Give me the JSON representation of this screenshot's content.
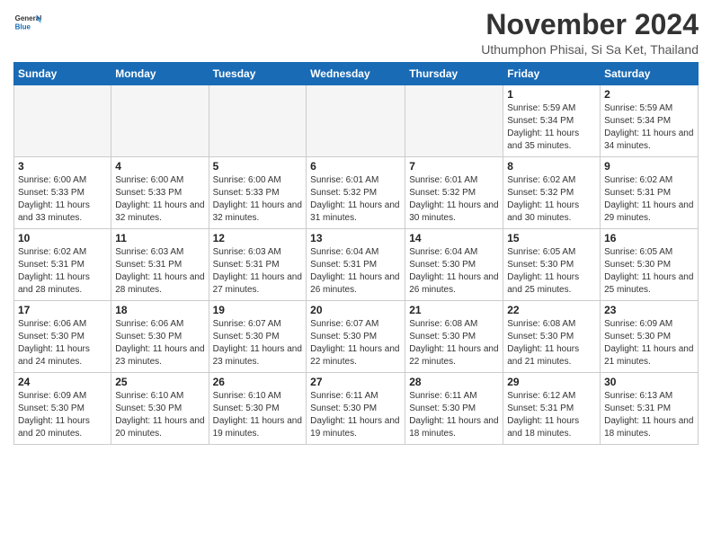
{
  "header": {
    "logo_line1": "General",
    "logo_line2": "Blue",
    "month": "November 2024",
    "location": "Uthumphon Phisai, Si Sa Ket, Thailand"
  },
  "days_of_week": [
    "Sunday",
    "Monday",
    "Tuesday",
    "Wednesday",
    "Thursday",
    "Friday",
    "Saturday"
  ],
  "weeks": [
    [
      {
        "day": "",
        "info": ""
      },
      {
        "day": "",
        "info": ""
      },
      {
        "day": "",
        "info": ""
      },
      {
        "day": "",
        "info": ""
      },
      {
        "day": "",
        "info": ""
      },
      {
        "day": "1",
        "info": "Sunrise: 5:59 AM\nSunset: 5:34 PM\nDaylight: 11 hours and 35 minutes."
      },
      {
        "day": "2",
        "info": "Sunrise: 5:59 AM\nSunset: 5:34 PM\nDaylight: 11 hours and 34 minutes."
      }
    ],
    [
      {
        "day": "3",
        "info": "Sunrise: 6:00 AM\nSunset: 5:33 PM\nDaylight: 11 hours and 33 minutes."
      },
      {
        "day": "4",
        "info": "Sunrise: 6:00 AM\nSunset: 5:33 PM\nDaylight: 11 hours and 32 minutes."
      },
      {
        "day": "5",
        "info": "Sunrise: 6:00 AM\nSunset: 5:33 PM\nDaylight: 11 hours and 32 minutes."
      },
      {
        "day": "6",
        "info": "Sunrise: 6:01 AM\nSunset: 5:32 PM\nDaylight: 11 hours and 31 minutes."
      },
      {
        "day": "7",
        "info": "Sunrise: 6:01 AM\nSunset: 5:32 PM\nDaylight: 11 hours and 30 minutes."
      },
      {
        "day": "8",
        "info": "Sunrise: 6:02 AM\nSunset: 5:32 PM\nDaylight: 11 hours and 30 minutes."
      },
      {
        "day": "9",
        "info": "Sunrise: 6:02 AM\nSunset: 5:31 PM\nDaylight: 11 hours and 29 minutes."
      }
    ],
    [
      {
        "day": "10",
        "info": "Sunrise: 6:02 AM\nSunset: 5:31 PM\nDaylight: 11 hours and 28 minutes."
      },
      {
        "day": "11",
        "info": "Sunrise: 6:03 AM\nSunset: 5:31 PM\nDaylight: 11 hours and 28 minutes."
      },
      {
        "day": "12",
        "info": "Sunrise: 6:03 AM\nSunset: 5:31 PM\nDaylight: 11 hours and 27 minutes."
      },
      {
        "day": "13",
        "info": "Sunrise: 6:04 AM\nSunset: 5:31 PM\nDaylight: 11 hours and 26 minutes."
      },
      {
        "day": "14",
        "info": "Sunrise: 6:04 AM\nSunset: 5:30 PM\nDaylight: 11 hours and 26 minutes."
      },
      {
        "day": "15",
        "info": "Sunrise: 6:05 AM\nSunset: 5:30 PM\nDaylight: 11 hours and 25 minutes."
      },
      {
        "day": "16",
        "info": "Sunrise: 6:05 AM\nSunset: 5:30 PM\nDaylight: 11 hours and 25 minutes."
      }
    ],
    [
      {
        "day": "17",
        "info": "Sunrise: 6:06 AM\nSunset: 5:30 PM\nDaylight: 11 hours and 24 minutes."
      },
      {
        "day": "18",
        "info": "Sunrise: 6:06 AM\nSunset: 5:30 PM\nDaylight: 11 hours and 23 minutes."
      },
      {
        "day": "19",
        "info": "Sunrise: 6:07 AM\nSunset: 5:30 PM\nDaylight: 11 hours and 23 minutes."
      },
      {
        "day": "20",
        "info": "Sunrise: 6:07 AM\nSunset: 5:30 PM\nDaylight: 11 hours and 22 minutes."
      },
      {
        "day": "21",
        "info": "Sunrise: 6:08 AM\nSunset: 5:30 PM\nDaylight: 11 hours and 22 minutes."
      },
      {
        "day": "22",
        "info": "Sunrise: 6:08 AM\nSunset: 5:30 PM\nDaylight: 11 hours and 21 minutes."
      },
      {
        "day": "23",
        "info": "Sunrise: 6:09 AM\nSunset: 5:30 PM\nDaylight: 11 hours and 21 minutes."
      }
    ],
    [
      {
        "day": "24",
        "info": "Sunrise: 6:09 AM\nSunset: 5:30 PM\nDaylight: 11 hours and 20 minutes."
      },
      {
        "day": "25",
        "info": "Sunrise: 6:10 AM\nSunset: 5:30 PM\nDaylight: 11 hours and 20 minutes."
      },
      {
        "day": "26",
        "info": "Sunrise: 6:10 AM\nSunset: 5:30 PM\nDaylight: 11 hours and 19 minutes."
      },
      {
        "day": "27",
        "info": "Sunrise: 6:11 AM\nSunset: 5:30 PM\nDaylight: 11 hours and 19 minutes."
      },
      {
        "day": "28",
        "info": "Sunrise: 6:11 AM\nSunset: 5:30 PM\nDaylight: 11 hours and 18 minutes."
      },
      {
        "day": "29",
        "info": "Sunrise: 6:12 AM\nSunset: 5:31 PM\nDaylight: 11 hours and 18 minutes."
      },
      {
        "day": "30",
        "info": "Sunrise: 6:13 AM\nSunset: 5:31 PM\nDaylight: 11 hours and 18 minutes."
      }
    ]
  ]
}
